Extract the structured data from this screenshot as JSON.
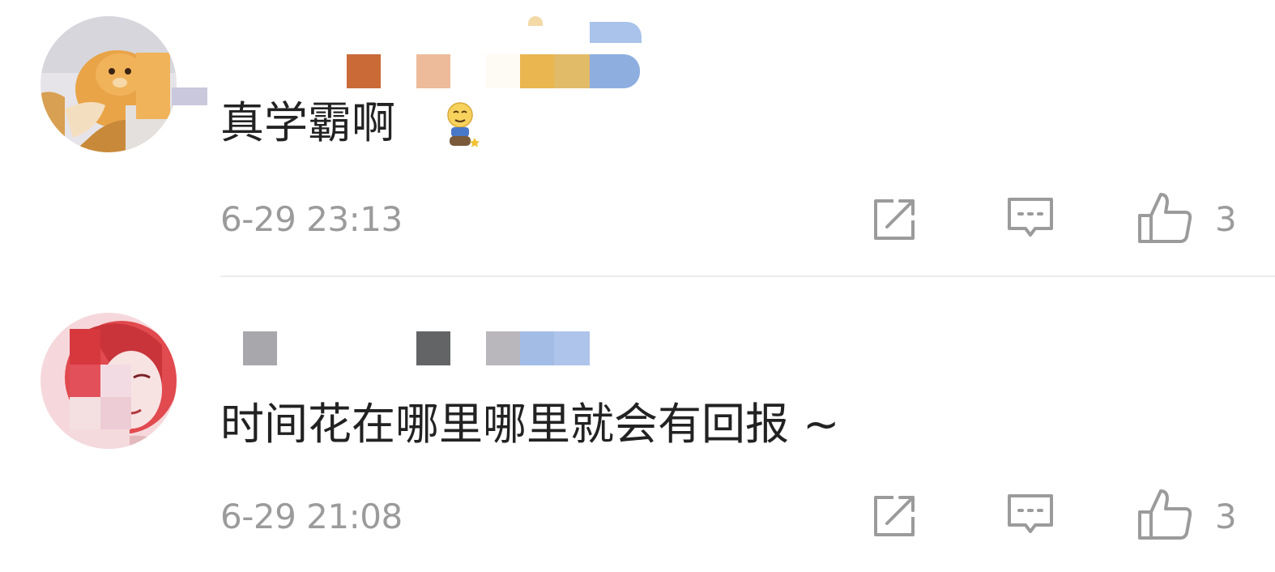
{
  "comments": [
    {
      "username_hidden": true,
      "text": "真学霸啊",
      "emoji_icon": "dizzy-face-emoji-icon",
      "timestamp": "6-29 23:13",
      "actions": {
        "share_icon": "share-icon",
        "reply_icon": "comment-icon",
        "like_icon": "thumbs-up-icon",
        "like_count": "3"
      }
    },
    {
      "username_hidden": true,
      "text": "时间花在哪里哪里就会有回报 ~",
      "timestamp": "6-29 21:08",
      "actions": {
        "share_icon": "share-icon",
        "reply_icon": "comment-icon",
        "like_icon": "thumbs-up-icon",
        "like_count": "3"
      }
    }
  ],
  "colors": {
    "text": "#222222",
    "meta": "#9b9b9b",
    "divider": "#ececec",
    "icon": "#9b9b9b"
  }
}
